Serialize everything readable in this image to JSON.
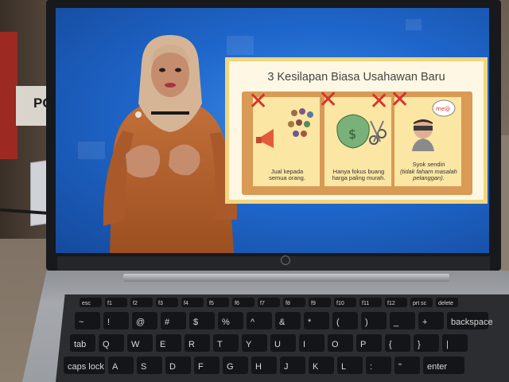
{
  "background": {
    "card_label": "PC"
  },
  "slide": {
    "title": "3 Kesilapan Biasa Usahawan Baru",
    "notes": [
      {
        "caption_line1": "Jual kepada",
        "caption_line2": "semua orang.",
        "icon": "megaphone-crowd-icon"
      },
      {
        "caption_line1": "Hanya fokus buang",
        "caption_line2": "harga paling murah.",
        "icon": "money-bag-scissors-icon"
      },
      {
        "caption_line1": "Syok sendiri",
        "caption_line2": "(tidak faham masalah",
        "caption_line3": "pelanggan).",
        "icon": "blindfold-person-icon"
      }
    ],
    "bubble_text": "me@",
    "colors": {
      "mistake_x": "#d8332a",
      "frame": "#f2d57e",
      "cork": "#d89a55",
      "note": "#fbe6a4"
    }
  },
  "presenter": {
    "description_icon": "presenter-in-hijab-icon",
    "colors": {
      "blouse": "#b8652c",
      "hijab": "#d8b79a"
    }
  },
  "keyboard": {
    "function_row": [
      "esc",
      "f1",
      "f2",
      "f3",
      "f4",
      "f5",
      "f6",
      "f7",
      "f8",
      "f9",
      "f10",
      "f11",
      "f12",
      "prt sc",
      "delete"
    ],
    "number_row": [
      "~",
      "!",
      "@",
      "#",
      "$",
      "%",
      "^",
      "&",
      "*",
      "(",
      ")",
      "_",
      "+",
      "backspace"
    ],
    "qwerty_row": [
      "tab",
      "Q",
      "W",
      "E",
      "R",
      "T",
      "Y",
      "U",
      "I",
      "O",
      "P",
      "{",
      "}",
      "|"
    ],
    "asdf_row": [
      "caps lock",
      "A",
      "S",
      "D",
      "F",
      "G",
      "H",
      "J",
      "K",
      "L",
      ":",
      "\"",
      "enter"
    ]
  },
  "colors": {
    "screen": "#1f67cc",
    "bezel": "#18191c",
    "chassis": "#a5a8ad"
  }
}
